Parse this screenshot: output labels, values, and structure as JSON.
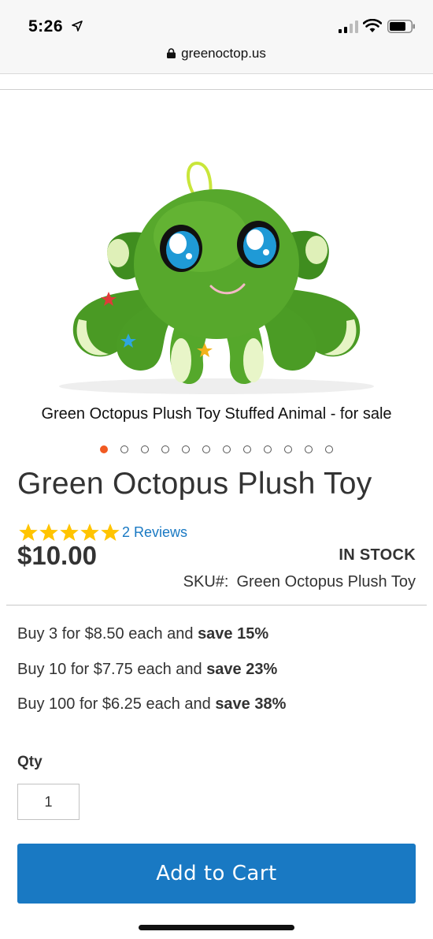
{
  "status_bar": {
    "time": "5:26"
  },
  "browser": {
    "url": "greenoctop.us"
  },
  "product": {
    "image_caption": "Green Octopus Plush Toy Stuffed Animal - for sale",
    "gallery_count": 12,
    "gallery_active_index": 0,
    "title": "Green Octopus Plush Toy",
    "rating": 5,
    "rating_max": 5,
    "reviews_label": "2 Reviews",
    "price": "$10.00",
    "stock_status": "IN STOCK",
    "sku_label": "SKU#:",
    "sku_value": "Green Octopus Plush Toy"
  },
  "tier_prices": [
    {
      "text": "Buy 3 for $8.50 each and ",
      "save": "save 15%"
    },
    {
      "text": "Buy 10 for $7.75 each and ",
      "save": "save 23%"
    },
    {
      "text": "Buy 100 for $6.25 each and ",
      "save": "save 38%"
    }
  ],
  "qty": {
    "label": "Qty",
    "value": "1"
  },
  "cart": {
    "button_label": "Add to Cart"
  },
  "colors": {
    "accent": "#1979c3",
    "active_dot": "#f15a22",
    "star": "#ffc400"
  }
}
